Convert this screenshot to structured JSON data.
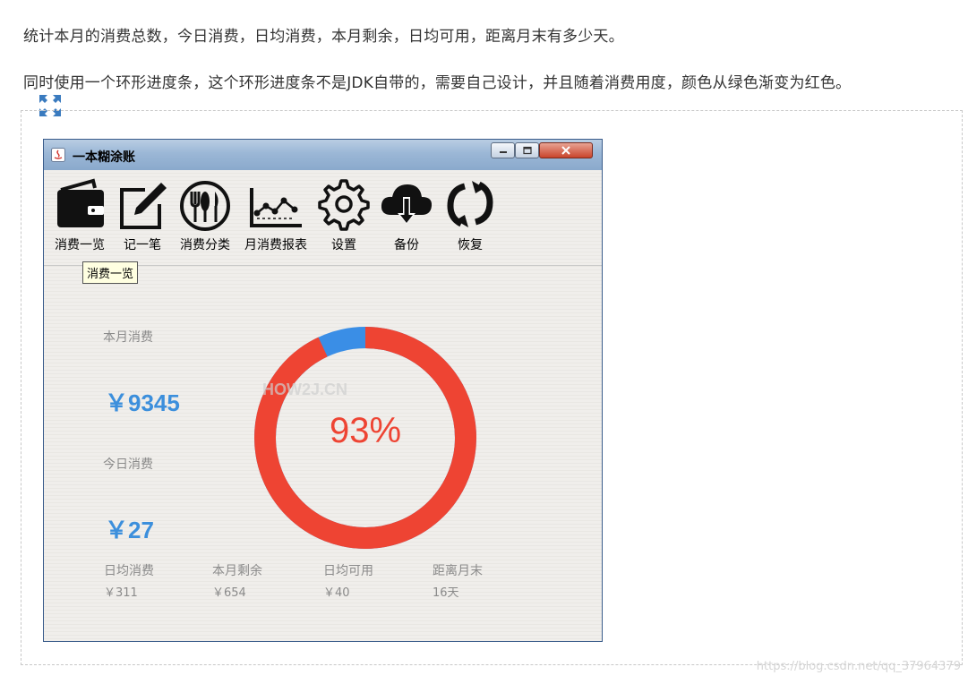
{
  "page": {
    "paragraph1": "统计本月的消费总数，今日消费，日均消费，本月剩余，日均可用，距离月末有多少天。",
    "paragraph2": "同时使用一个环形进度条，这个环形进度条不是JDK自带的，需要自己设计，并且随着消费用度，颜色从绿色渐变为红色。",
    "watermark": "https://blog.csdn.net/qq_37964379"
  },
  "window": {
    "title": "一本糊涂账"
  },
  "toolbar": {
    "items": [
      {
        "label": "消费一览",
        "icon": "wallet-icon"
      },
      {
        "label": "记一笔",
        "icon": "edit-icon"
      },
      {
        "label": "消费分类",
        "icon": "dining-icon"
      },
      {
        "label": "月消费报表",
        "icon": "report-chart-icon"
      },
      {
        "label": "设置",
        "icon": "gear-icon"
      },
      {
        "label": "备份",
        "icon": "cloud-download-icon"
      },
      {
        "label": "恢复",
        "icon": "refresh-icon"
      }
    ],
    "tooltip": "消费一览"
  },
  "stats": {
    "month_caption": "本月消费",
    "month_value": "￥9345",
    "today_caption": "今日消费",
    "today_value": "￥27",
    "daily_avg_caption": "日均消费",
    "daily_avg_value": "￥311",
    "remaining_caption": "本月剩余",
    "remaining_value": "￥654",
    "daily_available_caption": "日均可用",
    "daily_available_value": "￥40",
    "days_left_caption": "距离月末",
    "days_left_value": "16天"
  },
  "progress": {
    "percent_label": "93%",
    "fraction": 0.93,
    "color_used": "#ee4433",
    "color_rest": "#3a8ee6",
    "watermark": "HOW2J.CN"
  }
}
